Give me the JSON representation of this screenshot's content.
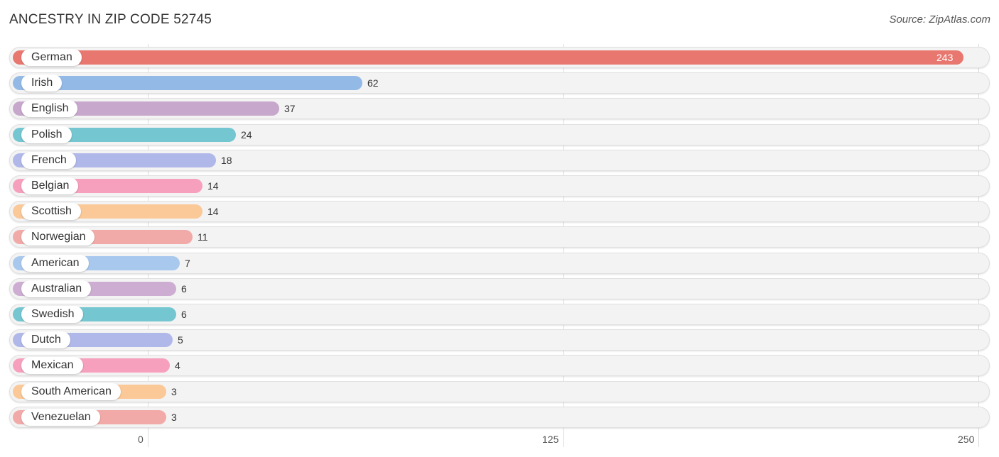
{
  "header": {
    "title": "ANCESTRY IN ZIP CODE 52745",
    "source": "Source: ZipAtlas.com"
  },
  "chart_data": {
    "type": "bar",
    "orientation": "horizontal",
    "title": "ANCESTRY IN ZIP CODE 52745",
    "xlabel": "",
    "ylabel": "",
    "xlim": [
      0,
      250
    ],
    "ticks": [
      0,
      125,
      250
    ],
    "tick_labels": [
      "0",
      "125",
      "250"
    ],
    "grid": true,
    "categories": [
      "German",
      "Irish",
      "English",
      "Polish",
      "French",
      "Belgian",
      "Scottish",
      "Norwegian",
      "American",
      "Australian",
      "Swedish",
      "Dutch",
      "Mexican",
      "South American",
      "Venezuelan"
    ],
    "values": [
      243,
      62,
      37,
      24,
      18,
      14,
      14,
      11,
      7,
      6,
      6,
      5,
      4,
      3,
      3
    ],
    "colors": [
      "#e8776f",
      "#93b9e6",
      "#c7a7cc",
      "#74c6d0",
      "#b0b8ea",
      "#f6a0bd",
      "#fbc898",
      "#f1aaa8",
      "#a8c8ee",
      "#cdaed2",
      "#74c6d0",
      "#b0b8ea",
      "#f6a0bd",
      "#fbc898",
      "#f1aaa8"
    ]
  }
}
